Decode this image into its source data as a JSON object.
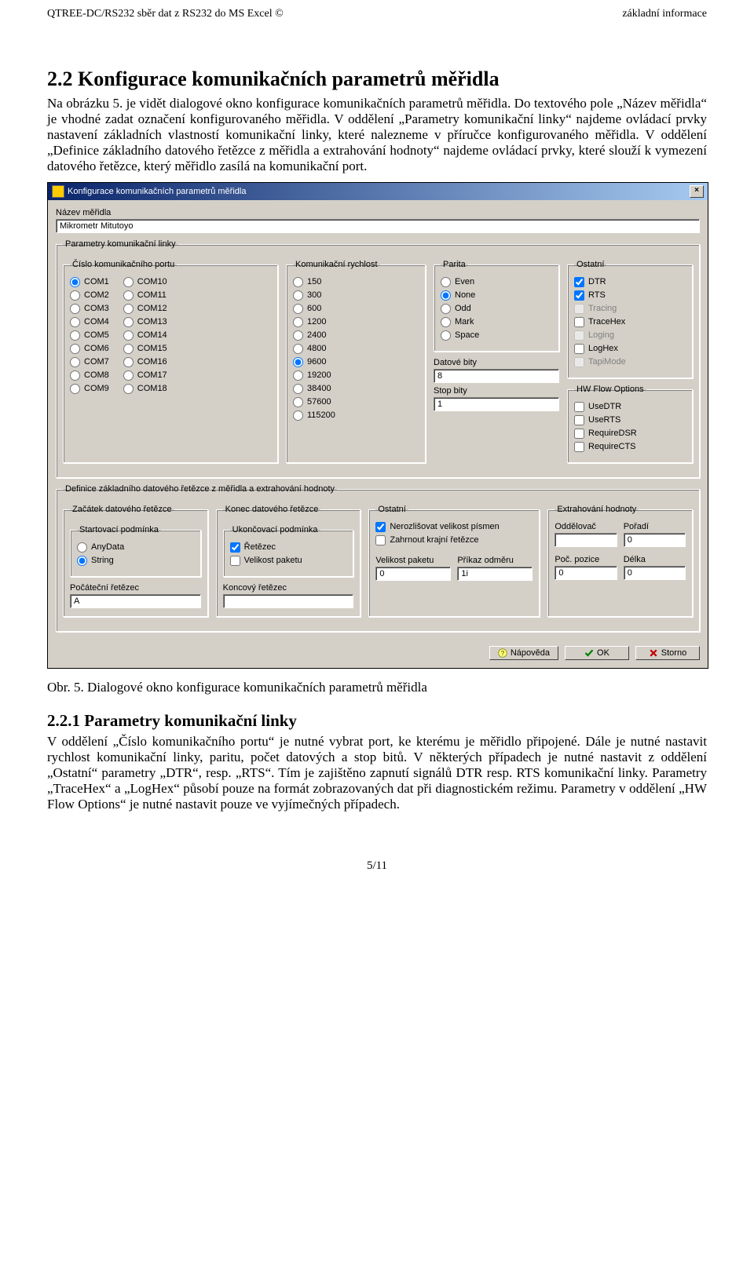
{
  "header": {
    "left": "QTREE-DC/RS232 sběr dat z RS232 do MS Excel ©",
    "right": "základní informace"
  },
  "section_title": "2.2  Konfigurace komunikačních parametrů měřidla",
  "para1": "Na obrázku 5. je vidět dialogové okno konfigurace komunikačních parametrů měřidla. Do textového pole „Název měřidla“ je vhodné zadat označení konfigurovaného měřidla. V oddělení „Parametry komunikační linky“ najdeme ovládací prvky nastavení základních vlastností komunikační linky, které nalezneme v příručce konfigurovaného měřidla. V oddělení „Definice základního datového řetězce z měřidla a extrahování hodnoty“ najdeme ovládací prvky, které slouží k vymezení datového řetězce, který měřidlo zasílá na komunikační port.",
  "caption": "Obr. 5. Dialogové okno konfigurace komunikačních parametrů měřidla",
  "subsection_title": "2.2.1  Parametry komunikační linky",
  "para2": "V oddělení „Číslo komunikačního portu“ je nutné vybrat port, ke kterému je měřidlo připojené. Dále je nutné nastavit rychlost komunikační linky, paritu, počet datových a stop bitů. V některých případech je nutné nastavit z oddělení „Ostatní“ parametry „DTR“, resp. „RTS“. Tím je zajištěno zapnutí signálů DTR resp. RTS komunikační linky. Parametry „TraceHex“ a „LogHex“ působí pouze na formát zobrazovaných dat při diagnostickém režimu. Parametry v oddělení „HW Flow Options“ je nutné nastavit pouze ve vyjímečných případech.",
  "page_no": "5/11",
  "dlg": {
    "title": "Konfigurace komunikačních parametrů měřidla",
    "name_label": "Název měřidla",
    "name_value": "Mikrometr Mitutoyo",
    "fs_comm": "Parametry komunikační linky",
    "port_label": "Číslo komunikačního portu",
    "ports_a": [
      "COM1",
      "COM2",
      "COM3",
      "COM4",
      "COM5",
      "COM6",
      "COM7",
      "COM8",
      "COM9"
    ],
    "ports_b": [
      "COM10",
      "COM11",
      "COM12",
      "COM13",
      "COM14",
      "COM15",
      "COM16",
      "COM17",
      "COM18"
    ],
    "port_selected": "COM1",
    "baud_label": "Komunikační rychlost",
    "bauds": [
      "150",
      "300",
      "600",
      "1200",
      "2400",
      "4800",
      "9600",
      "19200",
      "38400",
      "57600",
      "115200"
    ],
    "baud_selected": "9600",
    "parity_label": "Parita",
    "parities": [
      "Even",
      "None",
      "Odd",
      "Mark",
      "Space"
    ],
    "parity_selected": "None",
    "databits_label": "Datové bity",
    "databits_value": "8",
    "stopbits_label": "Stop bity",
    "stopbits_value": "1",
    "other_label": "Ostatní",
    "other_opts": [
      {
        "label": "DTR",
        "checked": true,
        "enabled": true
      },
      {
        "label": "RTS",
        "checked": true,
        "enabled": true
      },
      {
        "label": "Tracing",
        "checked": false,
        "enabled": false
      },
      {
        "label": "TraceHex",
        "checked": false,
        "enabled": true
      },
      {
        "label": "Loging",
        "checked": false,
        "enabled": false
      },
      {
        "label": "LogHex",
        "checked": false,
        "enabled": true
      },
      {
        "label": "TapiMode",
        "checked": false,
        "enabled": false
      }
    ],
    "hw_label": "HW Flow Options",
    "hw_opts": [
      {
        "label": "UseDTR",
        "checked": false
      },
      {
        "label": "UseRTS",
        "checked": false
      },
      {
        "label": "RequireDSR",
        "checked": false
      },
      {
        "label": "RequireCTS",
        "checked": false
      }
    ],
    "fs_data": "Definice základního datového řetězce z měřidla a extrahování hodnoty",
    "start_label": "Začátek datového řetězce",
    "start_cond_label": "Startovací podmínka",
    "start_opts": [
      "AnyData",
      "String"
    ],
    "start_selected": "String",
    "start_str_label": "Počáteční řetězec",
    "start_str_value": "A",
    "end_label": "Konec datového řetězce",
    "end_cond_label": "Ukončovací podmínka",
    "end_opts": [
      {
        "label": "Řetězec",
        "checked": true
      },
      {
        "label": "Velikost paketu",
        "checked": false
      }
    ],
    "end_str_label": "Koncový řetězec",
    "end_str_value": "",
    "other2_label": "Ostatní",
    "other2_opts": [
      {
        "label": "Nerozlišovat velikost písmen",
        "checked": true
      },
      {
        "label": "Zahrnout krajní řetězce",
        "checked": false
      }
    ],
    "packet_label": "Velikost paketu",
    "packet_value": "0",
    "cmd_label": "Příkaz odměru",
    "cmd_value": "1i",
    "extract_label": "Extrahování hodnoty",
    "delim_label": "Oddělovač",
    "delim_value": "",
    "order_label": "Pořadí",
    "order_value": "0",
    "pos_label": "Poč. pozice",
    "pos_value": "0",
    "len_label": "Délka",
    "len_value": "0",
    "btn_help": "Nápověda",
    "btn_ok": "OK",
    "btn_cancel": "Storno"
  }
}
